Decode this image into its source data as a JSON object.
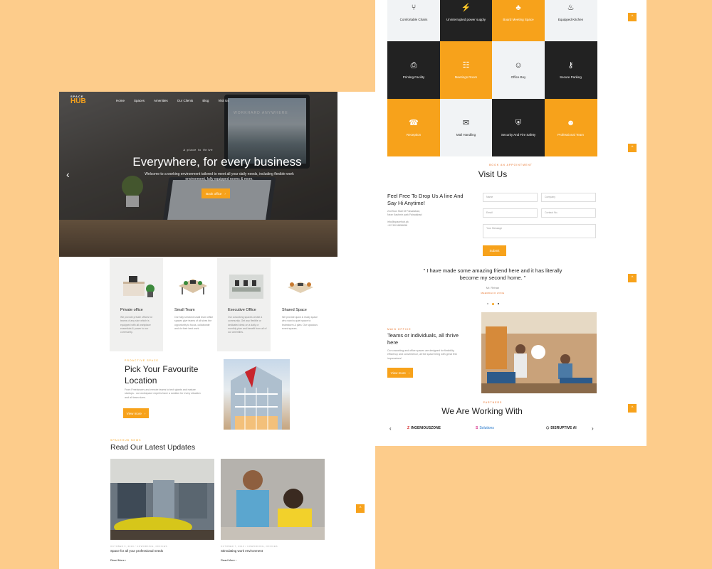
{
  "hero": {
    "logo_small": "SPACE",
    "logo_big": "HUB",
    "nav": [
      "Home",
      "Spaces",
      "Amenities",
      "Our Clients",
      "Blog",
      "Visit Us"
    ],
    "pre_title": "A place to thrive",
    "title": "Everywhere, for every business",
    "subtitle": "Welcome to a working environment tailored to meet all your daily needs, including flexible work environment, fully equipped rooms & more.",
    "button": "Book office",
    "monitor_text": "WORKHARD ANYWHERE"
  },
  "spaces": [
    {
      "title": "Private office",
      "text": "We provide private offices for teams of any size which is equipped with all workplace essentials & power to our community."
    },
    {
      "title": "Small Team",
      "text": "Our fully serviced small team office spaces give teams of all sizes the opportunity to focus, collaborate and do their best work."
    },
    {
      "title": "Executive Office",
      "text": "Our coworking spaces create a community. Get any flexible or dedicated desk on a daily or monthly plan and benefit from all of our amenities."
    },
    {
      "title": "Shared Space",
      "text": "We provide quick & ready space who want a quiet space to brainstorm & plan. Our spacious event spaces."
    }
  ],
  "pick": {
    "pre": "Proactive Space",
    "title_line1": "Pick Your Favourite",
    "title_line2": "Location",
    "text": "From Freelancers and remote teams to tech giants and mature startups - our workspace experts have a solution for every situation and all team sizes.",
    "button": "View more"
  },
  "news": {
    "pre": "Spacehub News",
    "title": "Read Our Latest Updates",
    "items": [
      {
        "meta": "OCTOBER 9, 2019 / COWORKING, OFFICES",
        "title": "Space for all your professional needs",
        "more": "Read More"
      },
      {
        "meta": "OCTOBER 7, 2019 / COWORKING, OFFICES",
        "title": "Stimulating work environment",
        "more": "Read More"
      }
    ]
  },
  "amenities": [
    {
      "label": "Comfortable Chairs",
      "icon": "chair-icon",
      "glyph": "⑂",
      "style": "w"
    },
    {
      "label": "Uninterrupted power supply",
      "icon": "power-icon",
      "glyph": "⚡",
      "style": "d"
    },
    {
      "label": "Board Meeting Space",
      "icon": "meeting-icon",
      "glyph": "♣",
      "style": "o"
    },
    {
      "label": "Equipped Kitchen",
      "icon": "kitchen-icon",
      "glyph": "♨",
      "style": "w"
    },
    {
      "label": "Printing Facility",
      "icon": "printer-icon",
      "glyph": "⎙",
      "style": "d"
    },
    {
      "label": "Meetings Room",
      "icon": "meetings-icon",
      "glyph": "☷",
      "style": "o"
    },
    {
      "label": "Office Boy",
      "icon": "person-icon",
      "glyph": "☺",
      "style": "w"
    },
    {
      "label": "Secure Parking",
      "icon": "key-icon",
      "glyph": "⚷",
      "style": "d"
    },
    {
      "label": "Reception",
      "icon": "reception-icon",
      "glyph": "☎",
      "style": "o"
    },
    {
      "label": "Mail Handling",
      "icon": "mail-icon",
      "glyph": "✉",
      "style": "w"
    },
    {
      "label": "Security And Fire Safety",
      "icon": "security-icon",
      "glyph": "⛨",
      "style": "d"
    },
    {
      "label": "Professional Team",
      "icon": "team-icon",
      "glyph": "☻",
      "style": "o"
    }
  ],
  "visit": {
    "pre": "Book an appointment",
    "title": "Visit Us",
    "heading": "Feel Free To Drop Us A line And Say Hi Anytime!",
    "address_line1": "2nd floor Mall Of Faisalabad,",
    "address_line2": "Near Kashmir park Faisalabad",
    "email": "info@spacehub.pk",
    "phone": "+92 300 8856658",
    "fields": {
      "name": "Name",
      "company": "Company",
      "email": "Email",
      "contact": "Contact No.",
      "message": "Your Message"
    },
    "submit": "Submit"
  },
  "testimonial": {
    "quote": "\" I have made some amazing friend here and it has literally become my second home. \"",
    "author": "Mr. Rehan",
    "company": "Meerdeco Zone"
  },
  "main_office": {
    "pre": "Main Office",
    "title": "Teams or individuals, all thrive here",
    "text": "Our coworking and office spaces are designed for flexibility, efficiency and convenience, all the space bring with great first impressions!",
    "button": "View more"
  },
  "partners": {
    "pre": "Partners",
    "title": "We Are Working With",
    "logos": [
      "INGENIOUSZONE",
      "Solutions",
      "DISRUPTIVE AI"
    ]
  },
  "colors": {
    "accent": "#f7a21b",
    "dark": "#222222",
    "background": "#fdcc8b"
  }
}
